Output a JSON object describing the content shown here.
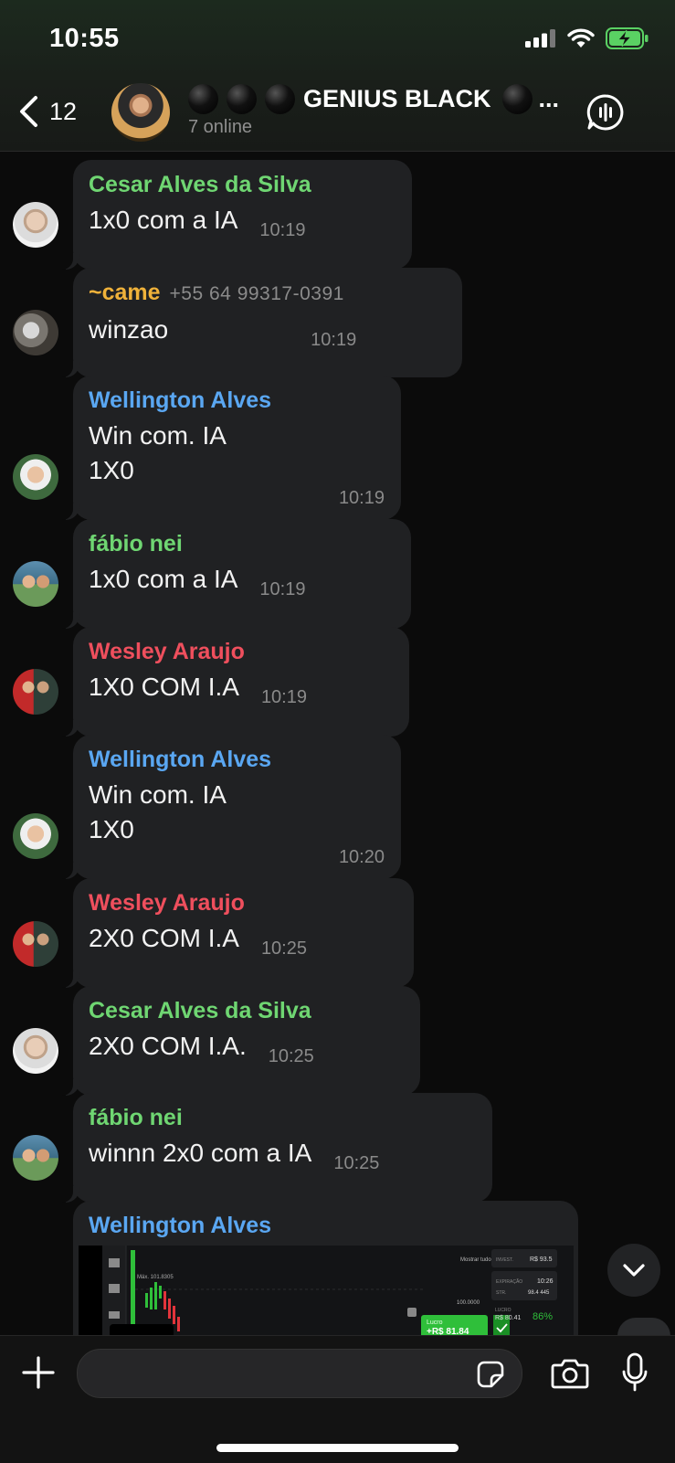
{
  "status_bar": {
    "time": "10:55"
  },
  "header": {
    "back_count": "12",
    "title": "GENIUS BLACK",
    "title_suffix": "...",
    "subtitle": "7 online"
  },
  "colors": {
    "green_name": "#6fd672",
    "yellow_name": "#f0b23a",
    "blue_name": "#5aa7f2",
    "red_name": "#ef4f5d",
    "bubble": "#202123"
  },
  "messages": [
    {
      "sender": "Cesar Alves da Silva",
      "text": "1x0 com a IA",
      "time": "10:19"
    },
    {
      "sender": "~came",
      "phone": "+55 64 99317-0391",
      "text": "winzao",
      "time": "10:19"
    },
    {
      "sender": "Wellington Alves",
      "line1": "Win com. IA",
      "line2": "1X0",
      "time": "10:19"
    },
    {
      "sender": "fábio nei",
      "text": "1x0 com a IA",
      "time": "10:19"
    },
    {
      "sender": "Wesley Araujo",
      "text": "1X0 COM I.A",
      "time": "10:19"
    },
    {
      "sender": "Wellington Alves",
      "line1": "Win com. IA",
      "line2": "1X0",
      "time": "10:20"
    },
    {
      "sender": "Wesley Araujo",
      "text": "2X0 COM I.A",
      "time": "10:25"
    },
    {
      "sender": "Cesar Alves da Silva",
      "text": "2X0 COM I.A.",
      "time": "10:25"
    },
    {
      "sender": "fábio nei",
      "text": "winnn 2x0 com a IA",
      "time": "10:25"
    },
    {
      "sender": "Wellington Alves"
    }
  ],
  "screenshot": {
    "max_label": "Máx. 101.8305",
    "show_all": "Mostrar tudo",
    "level": "100.0000",
    "investment_label": "INVEST.",
    "investment": "R$ 93.5",
    "expiry_label": "EXPIRAÇÃO",
    "expiry": "10:26",
    "strike_label": "STR.",
    "strike": "98.4 445",
    "profit_label": "LUCRO",
    "profit": "R$ 80.41",
    "profit_pct": "86%",
    "gain_label": "Lucro",
    "gain": "+R$ 81.84"
  }
}
